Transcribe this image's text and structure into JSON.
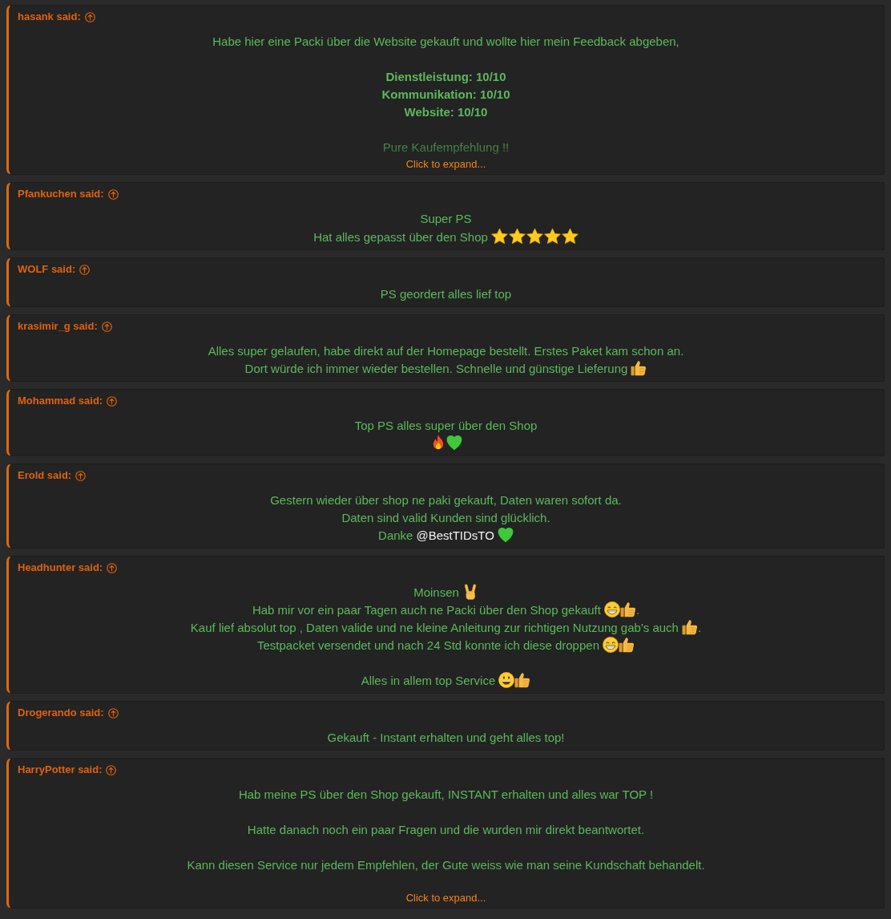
{
  "quotes": [
    {
      "author": "hasank said:",
      "collapsed": true,
      "expand_label": "Click to expand...",
      "paragraphs": [
        {
          "bold": false,
          "lines": [
            [
              {
                "kind": "text",
                "text": "Habe hier eine Packi über die Website gekauft und wollte hier mein Feedback abgeben,"
              }
            ]
          ]
        },
        {
          "bold": true,
          "lines": [
            [
              {
                "kind": "text",
                "text": "Dienstleistung: 10/10"
              }
            ],
            [
              {
                "kind": "text",
                "text": "Kommunikation: 10/10"
              }
            ],
            [
              {
                "kind": "text",
                "text": "Website: 10/10"
              }
            ]
          ]
        },
        {
          "bold": false,
          "lines": [
            [
              {
                "kind": "text",
                "text": "Pure Kaufempfehlung !!"
              }
            ]
          ]
        }
      ]
    },
    {
      "author": "Pfankuchen said:",
      "collapsed": false,
      "paragraphs": [
        {
          "bold": false,
          "lines": [
            [
              {
                "kind": "text",
                "text": "Super PS"
              }
            ],
            [
              {
                "kind": "text",
                "text": "Hat alles gepasst über den Shop"
              },
              {
                "kind": "stars",
                "stars": 5
              }
            ]
          ]
        }
      ]
    },
    {
      "author": "WOLF said:",
      "collapsed": false,
      "paragraphs": [
        {
          "bold": false,
          "lines": [
            [
              {
                "kind": "text",
                "text": "PS geordert alles lief top"
              }
            ]
          ]
        }
      ]
    },
    {
      "author": "krasimir_g said:",
      "collapsed": false,
      "paragraphs": [
        {
          "bold": false,
          "lines": [
            [
              {
                "kind": "text",
                "text": "Alles super gelaufen, habe direkt auf der Homepage bestellt. Erstes Paket kam schon an."
              }
            ],
            [
              {
                "kind": "text",
                "text": "Dort würde ich immer wieder bestellen. Schnelle und günstige Lieferung"
              },
              {
                "kind": "thumbs_up"
              }
            ]
          ]
        }
      ]
    },
    {
      "author": "Mohammad said:",
      "collapsed": false,
      "paragraphs": [
        {
          "bold": false,
          "lines": [
            [
              {
                "kind": "text",
                "text": "Top PS alles super über den Shop"
              }
            ],
            [
              {
                "kind": "fire"
              },
              {
                "kind": "heart"
              }
            ]
          ]
        }
      ]
    },
    {
      "author": "Erold said:",
      "collapsed": false,
      "paragraphs": [
        {
          "bold": false,
          "lines": [
            [
              {
                "kind": "text",
                "text": "Gestern wieder über shop ne paki gekauft, Daten waren sofort da."
              }
            ],
            [
              {
                "kind": "text",
                "text": "Daten sind valid Kunden sind glücklich."
              }
            ],
            [
              {
                "kind": "text",
                "text": "Danke"
              },
              {
                "kind": "mention",
                "text": "@BestTIDsTO"
              },
              {
                "kind": "heart"
              }
            ]
          ]
        }
      ]
    },
    {
      "author": "Headhunter said:",
      "collapsed": false,
      "paragraphs": [
        {
          "bold": false,
          "lines": [
            [
              {
                "kind": "text",
                "text": "Moinsen"
              },
              {
                "kind": "victory"
              }
            ],
            [
              {
                "kind": "text",
                "text": "Hab mir vor ein paar Tagen auch ne Packi über den Shop gekauft"
              },
              {
                "kind": "grin"
              },
              {
                "kind": "thumbs_up"
              },
              {
                "kind": "text",
                "text": "."
              }
            ],
            [
              {
                "kind": "text",
                "text": "Kauf lief absolut top , Daten valide und ne kleine Anleitung zur richtigen Nutzung gab's auch"
              },
              {
                "kind": "thumbs_up"
              },
              {
                "kind": "text",
                "text": "."
              }
            ],
            [
              {
                "kind": "text",
                "text": "Testpacket versendet und nach 24 Std konnte ich diese droppen"
              },
              {
                "kind": "grin"
              },
              {
                "kind": "thumbs_up"
              }
            ]
          ]
        },
        {
          "bold": false,
          "lines": [
            [
              {
                "kind": "text",
                "text": "Alles in allem top Service"
              },
              {
                "kind": "grinning"
              },
              {
                "kind": "thumbs_up"
              }
            ]
          ]
        }
      ]
    },
    {
      "author": "Drogerando said:",
      "collapsed": false,
      "paragraphs": [
        {
          "bold": false,
          "lines": [
            [
              {
                "kind": "text",
                "text": "Gekauft - Instant erhalten und geht alles top!"
              }
            ]
          ]
        }
      ]
    },
    {
      "author": "HarryPotter said:",
      "collapsed": true,
      "expand_label": "Click to expand...",
      "paragraphs": [
        {
          "bold": false,
          "lines": [
            [
              {
                "kind": "text",
                "text": "Hab meine PS über den Shop gekauft, INSTANT erhalten und alles war TOP !"
              }
            ]
          ]
        },
        {
          "bold": false,
          "lines": [
            [
              {
                "kind": "text",
                "text": "Hatte danach noch ein paar Fragen und die wurden mir direkt beantwortet."
              }
            ]
          ]
        },
        {
          "bold": false,
          "lines": [
            [
              {
                "kind": "text",
                "text": "Kann diesen Service nur jedem Empfehlen, der Gute weiss wie man seine Kundschaft behandelt."
              }
            ]
          ]
        }
      ]
    }
  ]
}
